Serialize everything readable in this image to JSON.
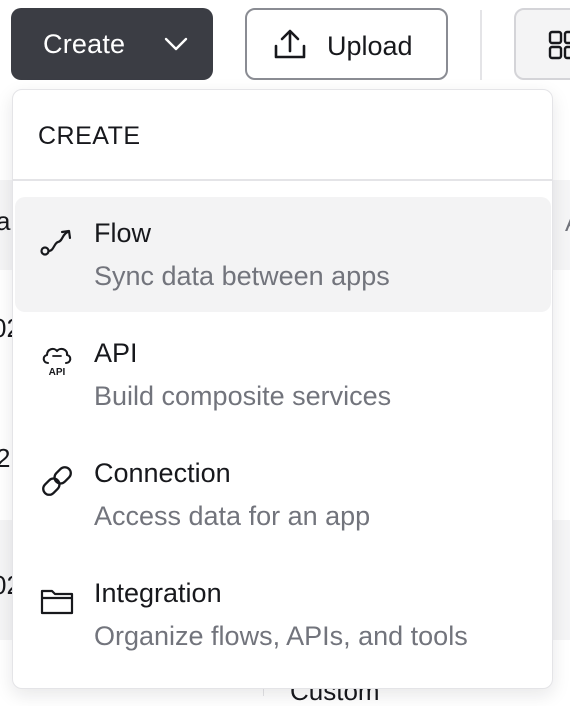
{
  "toolbar": {
    "create_label": "Create",
    "upload_label": "Upload"
  },
  "menu": {
    "header": "CREATE",
    "items": [
      {
        "title": "Flow",
        "description": "Sync data between apps",
        "icon": "flow-icon"
      },
      {
        "title": "API",
        "description": "Build composite services",
        "icon": "api-cloud-icon"
      },
      {
        "title": "Connection",
        "description": "Access data for an app",
        "icon": "link-icon"
      },
      {
        "title": "Integration",
        "description": "Organize flows, APIs, and tools",
        "icon": "folder-icon"
      }
    ]
  },
  "background": {
    "row_fragments": [
      "a",
      "02",
      "2",
      "02"
    ],
    "right_fragment": "A",
    "footer_fragment": "Custom"
  },
  "colors": {
    "create_button_bg": "#3b3d44",
    "menu_active_bg": "#f3f3f4",
    "description_text": "#72747c"
  }
}
